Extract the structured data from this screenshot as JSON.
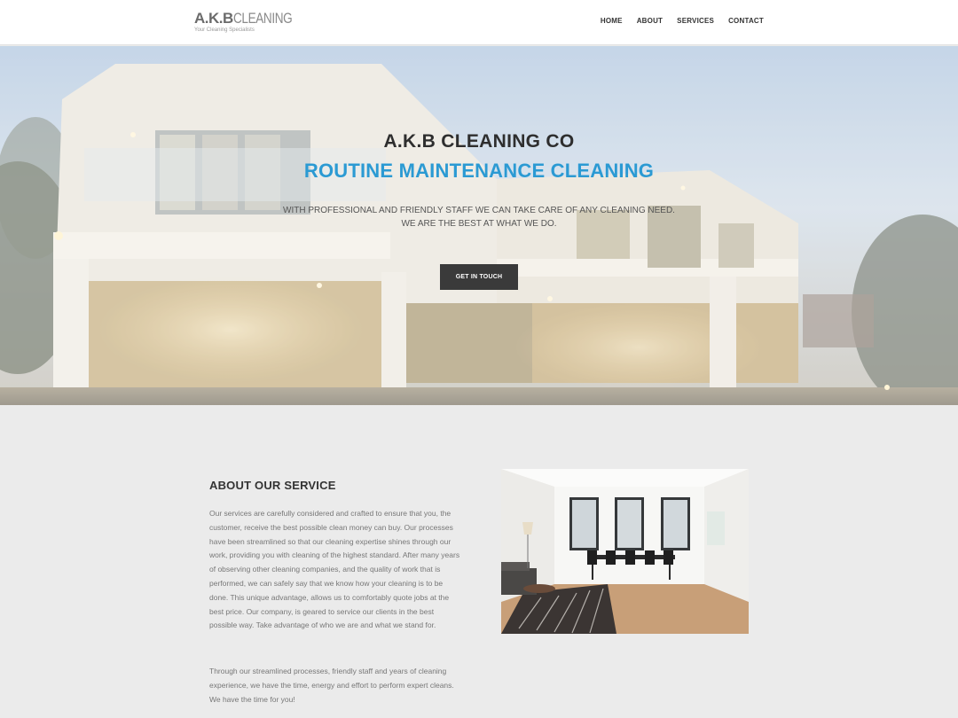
{
  "header": {
    "logo_main_bold": "A.K.B",
    "logo_main_light": "CLEANING",
    "logo_tagline": "Your Cleaning Specialists",
    "nav": [
      {
        "label": "HOME"
      },
      {
        "label": "ABOUT"
      },
      {
        "label": "SERVICES"
      },
      {
        "label": "CONTACT"
      }
    ]
  },
  "hero": {
    "title": "A.K.B CLEANING CO",
    "subtitle": "ROUTINE MAINTENANCE CLEANING",
    "text_line1": "WITH PROFESSIONAL AND FRIENDLY STAFF WE CAN TAKE CARE OF ANY CLEANING NEED.",
    "text_line2": "WE ARE THE BEST AT WHAT WE DO.",
    "button": "GET IN TOUCH",
    "accent_color": "#2b9ad3"
  },
  "about": {
    "title": "ABOUT OUR SERVICE",
    "paragraph1": "Our services are carefully considered and crafted to ensure that you, the customer, receive the best possible clean money can buy. Our processes have been streamlined so that our cleaning expertise shines through our work, providing you with cleaning of the highest standard. After many years of observing other cleaning companies, and the quality of work that is performed, we can safely say that we know how your cleaning is to be done. This unique advantage, allows us to comfortably quote jobs at the best price. Our company, is geared to service our clients in the best possible way. Take advantage of who we are and what we stand for.",
    "paragraph2": "Through our streamlined processes, friendly staff and years of cleaning experience, we have the time, energy and effort to perform expert cleans. We have the time for you!"
  }
}
